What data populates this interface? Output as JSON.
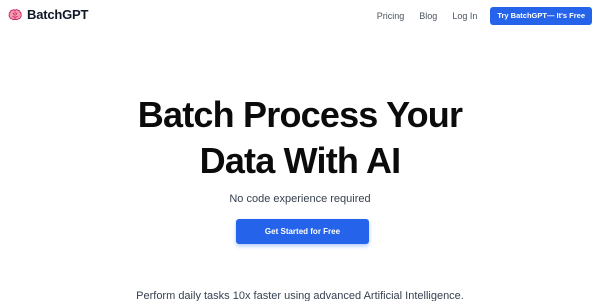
{
  "brand": {
    "name": "BatchGPT",
    "icon": "brain-icon",
    "icon_color": "#ef6f87"
  },
  "nav": {
    "links": [
      "Pricing",
      "Blog",
      "Log In"
    ],
    "cta_label": "Try BatchGPT— It's Free"
  },
  "hero": {
    "title_line1": "Batch Process Your",
    "title_line2": "Data With AI",
    "subtitle": "No code experience required",
    "cta_label": "Get Started for Free",
    "tagline": "Perform daily tasks 10x faster using advanced Artificial Intelligence."
  },
  "colors": {
    "accent": "#2563eb",
    "text": "#111827",
    "background": "#ffffff"
  }
}
